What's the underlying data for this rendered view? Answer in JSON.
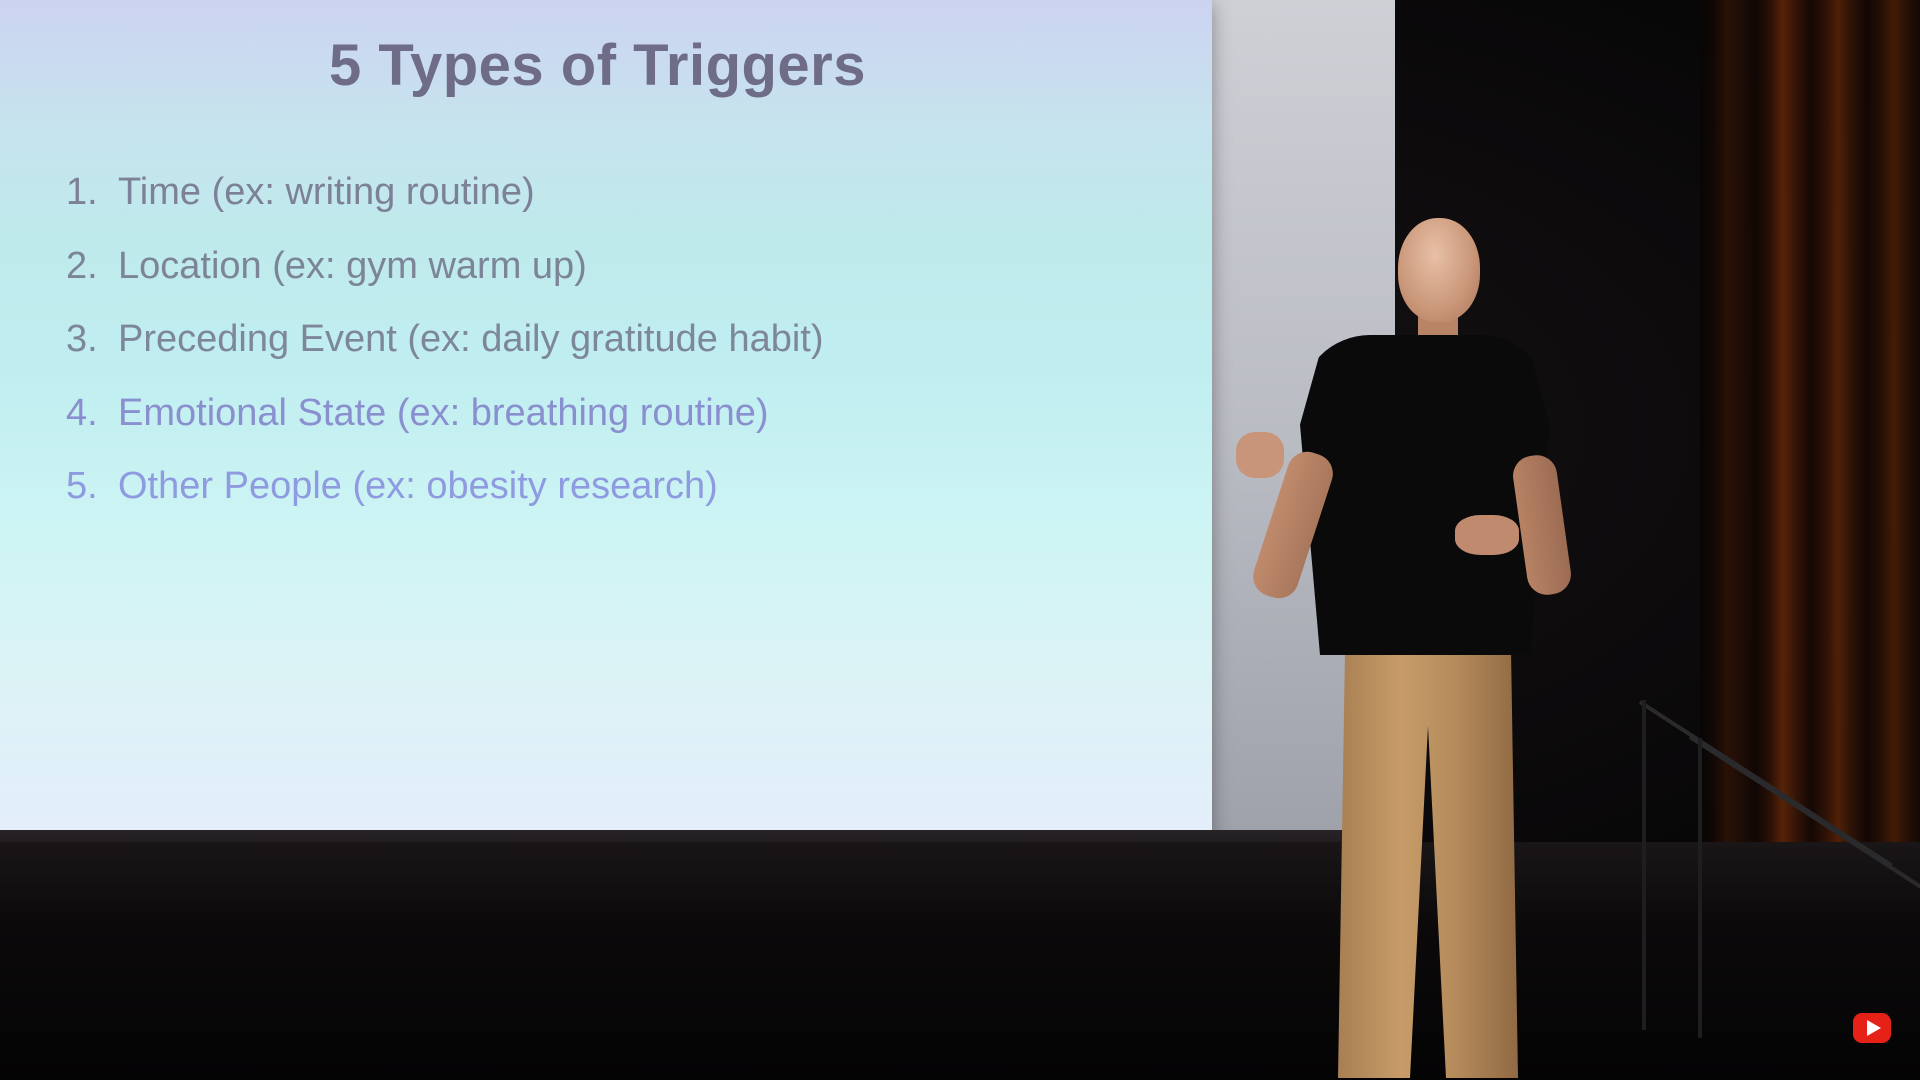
{
  "slide": {
    "title": "5 Types of Triggers",
    "items": [
      {
        "number": "1.",
        "text": "Time (ex: writing routine)"
      },
      {
        "number": "2.",
        "text": "Location (ex: gym warm up)"
      },
      {
        "number": "3.",
        "text": "Preceding Event (ex: daily gratitude habit)"
      },
      {
        "number": "4.",
        "text": "Emotional State (ex: breathing routine)"
      },
      {
        "number": "5.",
        "text": "Other People (ex: obesity research)"
      }
    ]
  },
  "colors": {
    "title": "#6f6c88",
    "logo_red": "#e62117"
  },
  "icons": {
    "watermark": "play-logo-icon"
  }
}
